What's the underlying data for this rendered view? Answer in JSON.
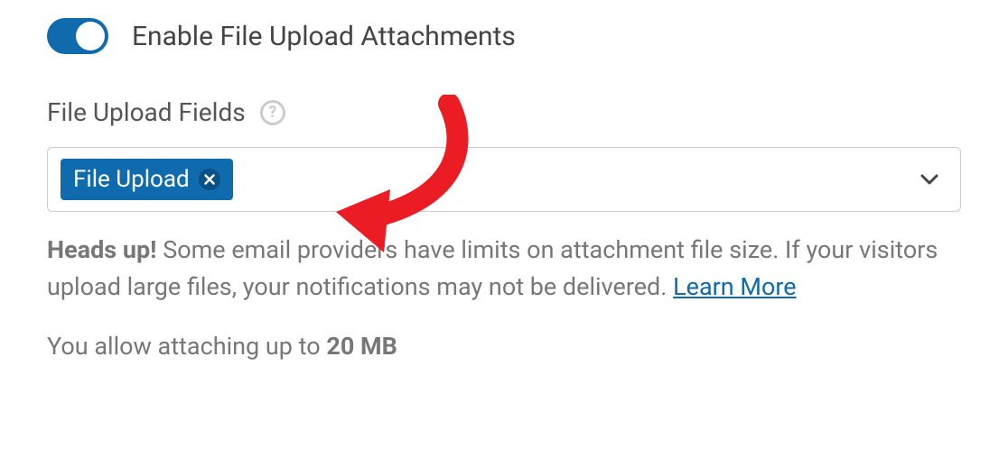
{
  "toggle": {
    "label": "Enable File Upload Attachments",
    "enabled": true
  },
  "field": {
    "label": "File Upload Fields",
    "chip": "File Upload"
  },
  "warning": {
    "heads_up": "Heads up!",
    "text": " Some email providers have limits on attachment file size. If your visitors upload large files, your notifications may not be delivered. ",
    "learn_more": "Learn More"
  },
  "limit": {
    "prefix": "You allow attaching up to ",
    "value": "20 MB"
  }
}
